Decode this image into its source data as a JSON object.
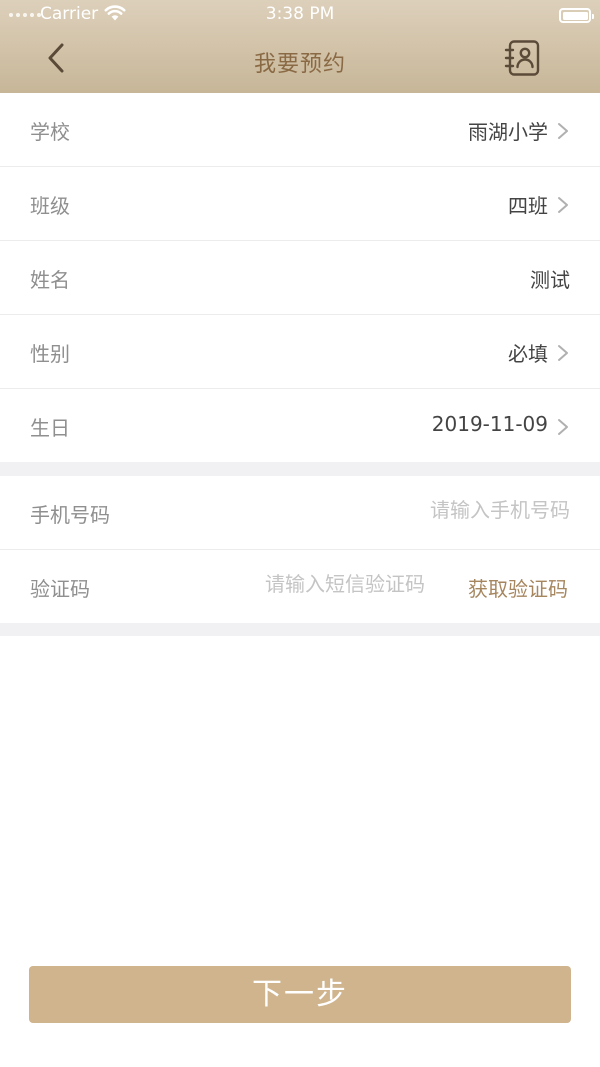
{
  "status_bar": {
    "carrier": "Carrier",
    "time": "3:38 PM"
  },
  "header": {
    "title": "我要预约"
  },
  "form": {
    "rows": [
      {
        "label": "学校",
        "value": "雨湖小学"
      },
      {
        "label": "班级",
        "value": "四班"
      },
      {
        "label": "姓名",
        "value": "测试"
      },
      {
        "label": "性别",
        "value": "必填"
      },
      {
        "label": "生日",
        "value": "2019-11-09"
      }
    ],
    "phone": {
      "label": "手机号码",
      "placeholder": "请输入手机号码"
    },
    "code": {
      "label": "验证码",
      "placeholder": "请输入短信验证码",
      "get_code_label": "获取验证码"
    }
  },
  "next_button": {
    "label": "下一步"
  },
  "colors": {
    "header_bg": "#cdbda0",
    "accent": "#a6865f",
    "button_bg": "#cfb48e"
  }
}
